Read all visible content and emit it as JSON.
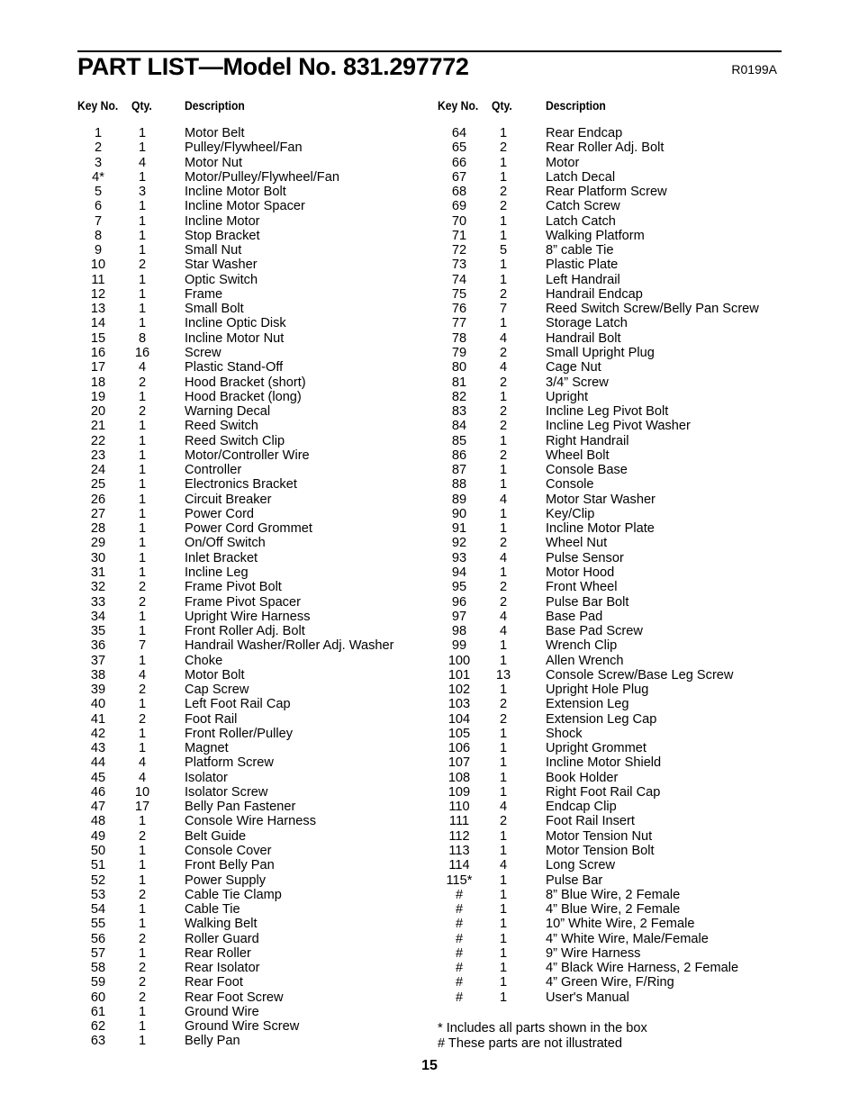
{
  "header": {
    "title": "PART LIST—Model No. 831.297772",
    "revision_code": "R0199A"
  },
  "columns": {
    "key_label": "Key No.",
    "qty_label": "Qty.",
    "desc_label": "Description"
  },
  "left_parts": [
    {
      "key": "1",
      "qty": "1",
      "desc": "Motor Belt"
    },
    {
      "key": "2",
      "qty": "1",
      "desc": "Pulley/Flywheel/Fan"
    },
    {
      "key": "3",
      "qty": "4",
      "desc": "Motor Nut"
    },
    {
      "key": "4*",
      "qty": "1",
      "desc": "Motor/Pulley/Flywheel/Fan"
    },
    {
      "key": "5",
      "qty": "3",
      "desc": "Incline Motor Bolt"
    },
    {
      "key": "6",
      "qty": "1",
      "desc": "Incline Motor Spacer"
    },
    {
      "key": "7",
      "qty": "1",
      "desc": "Incline Motor"
    },
    {
      "key": "8",
      "qty": "1",
      "desc": "Stop Bracket"
    },
    {
      "key": "9",
      "qty": "1",
      "desc": "Small Nut"
    },
    {
      "key": "10",
      "qty": "2",
      "desc": "Star Washer"
    },
    {
      "key": "11",
      "qty": "1",
      "desc": "Optic Switch"
    },
    {
      "key": "12",
      "qty": "1",
      "desc": "Frame"
    },
    {
      "key": "13",
      "qty": "1",
      "desc": "Small Bolt"
    },
    {
      "key": "14",
      "qty": "1",
      "desc": "Incline Optic Disk"
    },
    {
      "key": "15",
      "qty": "8",
      "desc": "Incline Motor Nut"
    },
    {
      "key": "16",
      "qty": "16",
      "desc": "Screw"
    },
    {
      "key": "17",
      "qty": "4",
      "desc": "Plastic Stand-Off"
    },
    {
      "key": "18",
      "qty": "2",
      "desc": "Hood Bracket (short)"
    },
    {
      "key": "19",
      "qty": "1",
      "desc": "Hood Bracket (long)"
    },
    {
      "key": "20",
      "qty": "2",
      "desc": "Warning Decal"
    },
    {
      "key": "21",
      "qty": "1",
      "desc": "Reed Switch"
    },
    {
      "key": "22",
      "qty": "1",
      "desc": "Reed Switch Clip"
    },
    {
      "key": "23",
      "qty": "1",
      "desc": "Motor/Controller Wire"
    },
    {
      "key": "24",
      "qty": "1",
      "desc": "Controller"
    },
    {
      "key": "25",
      "qty": "1",
      "desc": "Electronics Bracket"
    },
    {
      "key": "26",
      "qty": "1",
      "desc": "Circuit Breaker"
    },
    {
      "key": "27",
      "qty": "1",
      "desc": "Power Cord"
    },
    {
      "key": "28",
      "qty": "1",
      "desc": "Power Cord Grommet"
    },
    {
      "key": "29",
      "qty": "1",
      "desc": "On/Off Switch"
    },
    {
      "key": "30",
      "qty": "1",
      "desc": "Inlet Bracket"
    },
    {
      "key": "31",
      "qty": "1",
      "desc": "Incline Leg"
    },
    {
      "key": "32",
      "qty": "2",
      "desc": "Frame Pivot Bolt"
    },
    {
      "key": "33",
      "qty": "2",
      "desc": "Frame Pivot Spacer"
    },
    {
      "key": "34",
      "qty": "1",
      "desc": "Upright Wire Harness"
    },
    {
      "key": "35",
      "qty": "1",
      "desc": "Front Roller Adj. Bolt"
    },
    {
      "key": "36",
      "qty": "7",
      "desc": "Handrail Washer/Roller Adj. Washer"
    },
    {
      "key": "37",
      "qty": "1",
      "desc": "Choke"
    },
    {
      "key": "38",
      "qty": "4",
      "desc": "Motor Bolt"
    },
    {
      "key": "39",
      "qty": "2",
      "desc": "Cap Screw"
    },
    {
      "key": "40",
      "qty": "1",
      "desc": "Left Foot Rail Cap"
    },
    {
      "key": "41",
      "qty": "2",
      "desc": "Foot Rail"
    },
    {
      "key": "42",
      "qty": "1",
      "desc": "Front Roller/Pulley"
    },
    {
      "key": "43",
      "qty": "1",
      "desc": "Magnet"
    },
    {
      "key": "44",
      "qty": "4",
      "desc": "Platform Screw"
    },
    {
      "key": "45",
      "qty": "4",
      "desc": "Isolator"
    },
    {
      "key": "46",
      "qty": "10",
      "desc": "Isolator Screw"
    },
    {
      "key": "47",
      "qty": "17",
      "desc": "Belly Pan Fastener"
    },
    {
      "key": "48",
      "qty": "1",
      "desc": "Console Wire Harness"
    },
    {
      "key": "49",
      "qty": "2",
      "desc": "Belt Guide"
    },
    {
      "key": "50",
      "qty": "1",
      "desc": "Console Cover"
    },
    {
      "key": "51",
      "qty": "1",
      "desc": "Front Belly Pan"
    },
    {
      "key": "52",
      "qty": "1",
      "desc": "Power Supply"
    },
    {
      "key": "53",
      "qty": "2",
      "desc": "Cable Tie Clamp"
    },
    {
      "key": "54",
      "qty": "1",
      "desc": "Cable Tie"
    },
    {
      "key": "55",
      "qty": "1",
      "desc": "Walking Belt"
    },
    {
      "key": "56",
      "qty": "2",
      "desc": "Roller Guard"
    },
    {
      "key": "57",
      "qty": "1",
      "desc": "Rear Roller"
    },
    {
      "key": "58",
      "qty": "2",
      "desc": "Rear Isolator"
    },
    {
      "key": "59",
      "qty": "2",
      "desc": "Rear Foot"
    },
    {
      "key": "60",
      "qty": "2",
      "desc": "Rear Foot Screw"
    },
    {
      "key": "61",
      "qty": "1",
      "desc": "Ground Wire"
    },
    {
      "key": "62",
      "qty": "1",
      "desc": "Ground Wire Screw"
    },
    {
      "key": "63",
      "qty": "1",
      "desc": "Belly Pan"
    }
  ],
  "right_parts": [
    {
      "key": "64",
      "qty": "1",
      "desc": "Rear Endcap"
    },
    {
      "key": "65",
      "qty": "2",
      "desc": "Rear Roller Adj. Bolt"
    },
    {
      "key": "66",
      "qty": "1",
      "desc": "Motor"
    },
    {
      "key": "67",
      "qty": "1",
      "desc": "Latch Decal"
    },
    {
      "key": "68",
      "qty": "2",
      "desc": "Rear Platform Screw"
    },
    {
      "key": "69",
      "qty": "2",
      "desc": "Catch Screw"
    },
    {
      "key": "70",
      "qty": "1",
      "desc": "Latch Catch"
    },
    {
      "key": "71",
      "qty": "1",
      "desc": "Walking Platform"
    },
    {
      "key": "72",
      "qty": "5",
      "desc": "8” cable Tie"
    },
    {
      "key": "73",
      "qty": "1",
      "desc": "Plastic Plate"
    },
    {
      "key": "74",
      "qty": "1",
      "desc": "Left Handrail"
    },
    {
      "key": "75",
      "qty": "2",
      "desc": "Handrail Endcap"
    },
    {
      "key": "76",
      "qty": "7",
      "desc": "Reed Switch Screw/Belly Pan Screw"
    },
    {
      "key": "77",
      "qty": "1",
      "desc": "Storage Latch"
    },
    {
      "key": "78",
      "qty": "4",
      "desc": "Handrail Bolt"
    },
    {
      "key": "79",
      "qty": "2",
      "desc": "Small Upright Plug"
    },
    {
      "key": "80",
      "qty": "4",
      "desc": "Cage Nut"
    },
    {
      "key": "81",
      "qty": "2",
      "desc": "3/4” Screw"
    },
    {
      "key": "82",
      "qty": "1",
      "desc": "Upright"
    },
    {
      "key": "83",
      "qty": "2",
      "desc": "Incline Leg Pivot Bolt"
    },
    {
      "key": "84",
      "qty": "2",
      "desc": "Incline Leg Pivot Washer"
    },
    {
      "key": "85",
      "qty": "1",
      "desc": "Right Handrail"
    },
    {
      "key": "86",
      "qty": "2",
      "desc": "Wheel Bolt"
    },
    {
      "key": "87",
      "qty": "1",
      "desc": "Console Base"
    },
    {
      "key": "88",
      "qty": "1",
      "desc": "Console"
    },
    {
      "key": "89",
      "qty": "4",
      "desc": "Motor Star Washer"
    },
    {
      "key": "90",
      "qty": "1",
      "desc": "Key/Clip"
    },
    {
      "key": "91",
      "qty": "1",
      "desc": "Incline Motor Plate"
    },
    {
      "key": "92",
      "qty": "2",
      "desc": "Wheel Nut"
    },
    {
      "key": "93",
      "qty": "4",
      "desc": "Pulse Sensor"
    },
    {
      "key": "94",
      "qty": "1",
      "desc": "Motor Hood"
    },
    {
      "key": "95",
      "qty": "2",
      "desc": "Front Wheel"
    },
    {
      "key": "96",
      "qty": "2",
      "desc": "Pulse Bar Bolt"
    },
    {
      "key": "97",
      "qty": "4",
      "desc": "Base Pad"
    },
    {
      "key": "98",
      "qty": "4",
      "desc": "Base Pad Screw"
    },
    {
      "key": "99",
      "qty": "1",
      "desc": "Wrench Clip"
    },
    {
      "key": "100",
      "qty": "1",
      "desc": "Allen Wrench"
    },
    {
      "key": "101",
      "qty": "13",
      "desc": "Console Screw/Base Leg Screw"
    },
    {
      "key": "102",
      "qty": "1",
      "desc": "Upright Hole Plug"
    },
    {
      "key": "103",
      "qty": "2",
      "desc": "Extension Leg"
    },
    {
      "key": "104",
      "qty": "2",
      "desc": "Extension Leg Cap"
    },
    {
      "key": "105",
      "qty": "1",
      "desc": "Shock"
    },
    {
      "key": "106",
      "qty": "1",
      "desc": "Upright Grommet"
    },
    {
      "key": "107",
      "qty": "1",
      "desc": "Incline Motor Shield"
    },
    {
      "key": "108",
      "qty": "1",
      "desc": "Book Holder"
    },
    {
      "key": "109",
      "qty": "1",
      "desc": "Right Foot Rail Cap"
    },
    {
      "key": "110",
      "qty": "4",
      "desc": "Endcap Clip"
    },
    {
      "key": "111",
      "qty": "2",
      "desc": "Foot Rail Insert"
    },
    {
      "key": "112",
      "qty": "1",
      "desc": "Motor Tension Nut"
    },
    {
      "key": "113",
      "qty": "1",
      "desc": "Motor Tension Bolt"
    },
    {
      "key": "114",
      "qty": "4",
      "desc": "Long Screw"
    },
    {
      "key": "115*",
      "qty": "1",
      "desc": "Pulse Bar"
    },
    {
      "key": "#",
      "qty": "1",
      "desc": "8” Blue Wire, 2 Female"
    },
    {
      "key": "#",
      "qty": "1",
      "desc": "4” Blue Wire, 2 Female"
    },
    {
      "key": "#",
      "qty": "1",
      "desc": "10” White Wire, 2 Female"
    },
    {
      "key": "#",
      "qty": "1",
      "desc": "4” White Wire, Male/Female"
    },
    {
      "key": "#",
      "qty": "1",
      "desc": "9” Wire Harness"
    },
    {
      "key": "#",
      "qty": "1",
      "desc": "4” Black Wire Harness, 2 Female"
    },
    {
      "key": "#",
      "qty": "1",
      "desc": "4” Green Wire, F/Ring"
    },
    {
      "key": "#",
      "qty": "1",
      "desc": "User's Manual"
    }
  ],
  "notes": {
    "asterisk": "* Includes all parts shown in the box",
    "hash": "# These parts are not illustrated"
  },
  "page_number": "15"
}
